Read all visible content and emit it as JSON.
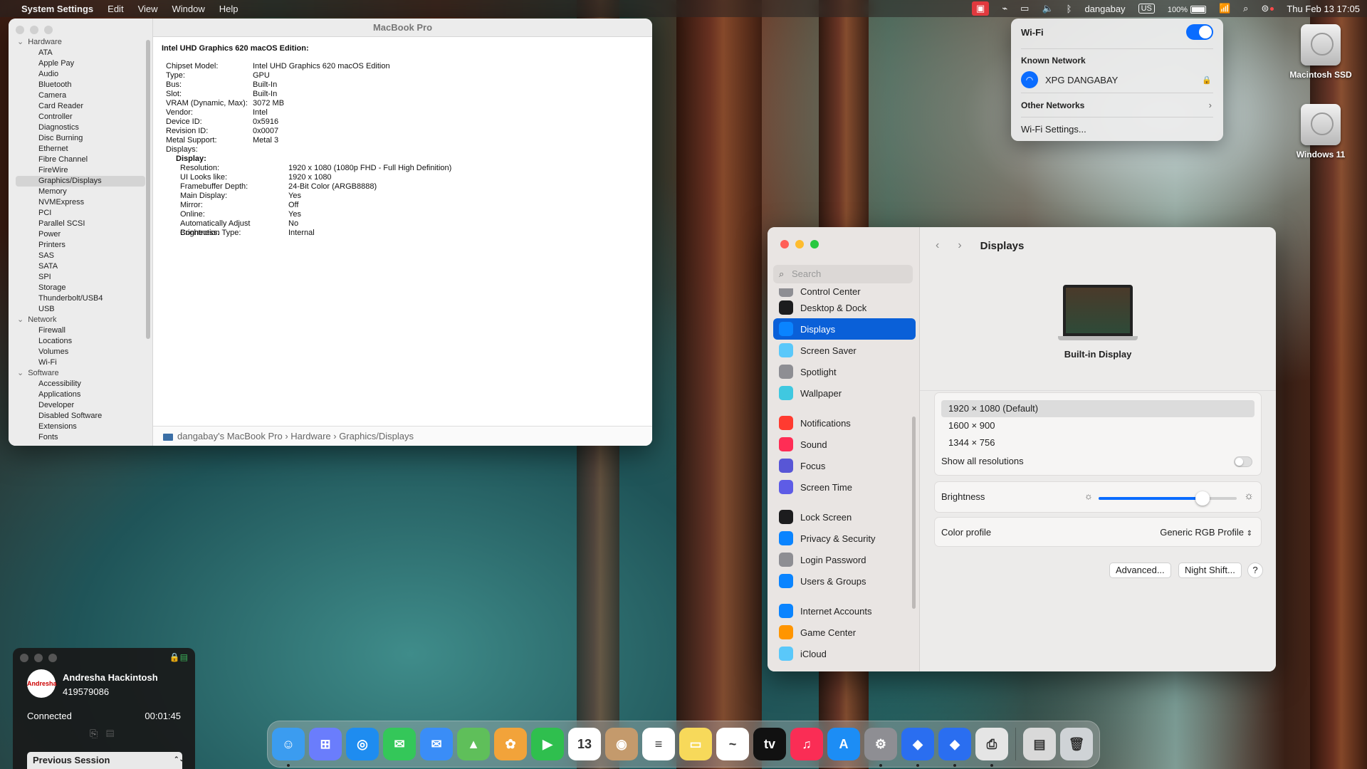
{
  "menubar": {
    "apple": "",
    "app": "System Settings",
    "menus": [
      "Edit",
      "View",
      "Window",
      "Help"
    ],
    "user": "dangabay",
    "input": "US",
    "battery": "100%",
    "datetime": "Thu Feb 13  17:05"
  },
  "info_window": {
    "title": "MacBook Pro",
    "sidebar": [
      {
        "label": "Hardware",
        "group": true
      },
      {
        "label": "ATA"
      },
      {
        "label": "Apple Pay"
      },
      {
        "label": "Audio"
      },
      {
        "label": "Bluetooth"
      },
      {
        "label": "Camera"
      },
      {
        "label": "Card Reader"
      },
      {
        "label": "Controller"
      },
      {
        "label": "Diagnostics"
      },
      {
        "label": "Disc Burning"
      },
      {
        "label": "Ethernet"
      },
      {
        "label": "Fibre Channel"
      },
      {
        "label": "FireWire"
      },
      {
        "label": "Graphics/Displays",
        "selected": true
      },
      {
        "label": "Memory"
      },
      {
        "label": "NVMExpress"
      },
      {
        "label": "PCI"
      },
      {
        "label": "Parallel SCSI"
      },
      {
        "label": "Power"
      },
      {
        "label": "Printers"
      },
      {
        "label": "SAS"
      },
      {
        "label": "SATA"
      },
      {
        "label": "SPI"
      },
      {
        "label": "Storage"
      },
      {
        "label": "Thunderbolt/USB4"
      },
      {
        "label": "USB"
      },
      {
        "label": "Network",
        "group": true
      },
      {
        "label": "Firewall"
      },
      {
        "label": "Locations"
      },
      {
        "label": "Volumes"
      },
      {
        "label": "Wi-Fi"
      },
      {
        "label": "Software",
        "group": true
      },
      {
        "label": "Accessibility"
      },
      {
        "label": "Applications"
      },
      {
        "label": "Developer"
      },
      {
        "label": "Disabled Software"
      },
      {
        "label": "Extensions"
      },
      {
        "label": "Fonts"
      }
    ],
    "heading": "Intel UHD Graphics 620 macOS Edition:",
    "fields": [
      [
        "Chipset Model:",
        "Intel UHD Graphics 620 macOS Edition"
      ],
      [
        "Type:",
        "GPU"
      ],
      [
        "Bus:",
        "Built-In"
      ],
      [
        "Slot:",
        "Built-In"
      ],
      [
        "VRAM (Dynamic, Max):",
        "3072 MB"
      ],
      [
        "Vendor:",
        "Intel"
      ],
      [
        "Device ID:",
        "0x5916"
      ],
      [
        "Revision ID:",
        "0x0007"
      ],
      [
        "Metal Support:",
        "Metal 3"
      ],
      [
        "Displays:",
        ""
      ]
    ],
    "display_heading": "Display:",
    "display_fields": [
      [
        "Resolution:",
        "1920 x 1080 (1080p FHD - Full High Definition)"
      ],
      [
        "UI Looks like:",
        "1920 x 1080"
      ],
      [
        "Framebuffer Depth:",
        "24-Bit Color (ARGB8888)"
      ],
      [
        "Main Display:",
        "Yes"
      ],
      [
        "Mirror:",
        "Off"
      ],
      [
        "Online:",
        "Yes"
      ],
      [
        "Automatically Adjust Brightness:",
        "No"
      ],
      [
        "Connection Type:",
        "Internal"
      ]
    ],
    "breadcrumb": "dangabay's MacBook Pro  ›  Hardware  ›  Graphics/Displays"
  },
  "wifi": {
    "title": "Wi-Fi",
    "known_label": "Known Network",
    "network": "XPG DANGABAY",
    "other": "Other Networks",
    "settings": "Wi-Fi Settings..."
  },
  "desktop": {
    "disk1": "Macintosh SSD",
    "disk2": "Windows 11"
  },
  "settings": {
    "search_placeholder": "Search",
    "sidebar": [
      {
        "label": "Control Center",
        "color": "#8e8e93",
        "partial": true
      },
      {
        "label": "Desktop & Dock",
        "color": "#1c1c1e"
      },
      {
        "label": "Displays",
        "color": "#0a84ff",
        "selected": true
      },
      {
        "label": "Screen Saver",
        "color": "#5ac8fa"
      },
      {
        "label": "Spotlight",
        "color": "#8e8e93"
      },
      {
        "label": "Wallpaper",
        "color": "#40c8e0",
        "gap_after": true
      },
      {
        "label": "Notifications",
        "color": "#ff3b30"
      },
      {
        "label": "Sound",
        "color": "#ff2d55"
      },
      {
        "label": "Focus",
        "color": "#5856d6"
      },
      {
        "label": "Screen Time",
        "color": "#5e5ce6",
        "gap_after": true
      },
      {
        "label": "Lock Screen",
        "color": "#1c1c1e"
      },
      {
        "label": "Privacy & Security",
        "color": "#0a84ff"
      },
      {
        "label": "Login Password",
        "color": "#8e8e93"
      },
      {
        "label": "Users & Groups",
        "color": "#0a84ff",
        "gap_after": true
      },
      {
        "label": "Internet Accounts",
        "color": "#0a84ff"
      },
      {
        "label": "Game Center",
        "color": "#ff9500"
      },
      {
        "label": "iCloud",
        "color": "#5ac8fa"
      }
    ],
    "page_title": "Displays",
    "display_name": "Built-in Display",
    "resolutions": [
      "1920 × 1080 (Default)",
      "1600 × 900",
      "1344 × 756"
    ],
    "show_all": "Show all resolutions",
    "brightness_label": "Brightness",
    "brightness": 0.75,
    "color_profile_label": "Color profile",
    "color_profile": "Generic RGB Profile",
    "advanced": "Advanced...",
    "night_shift": "Night Shift...",
    "help": "?"
  },
  "remote": {
    "name": "Andresha Hackintosh",
    "id": "419579086",
    "status": "Connected",
    "time": "00:01:45",
    "session": "Previous Session",
    "avatar": "Andresha"
  },
  "dock": [
    {
      "name": "finder",
      "color": "#3b9cf0",
      "glyph": "☺",
      "run": true
    },
    {
      "name": "launchpad",
      "color": "#6a7dfc",
      "glyph": "⊞"
    },
    {
      "name": "safari",
      "color": "#1e8cf0",
      "glyph": "◎"
    },
    {
      "name": "messages",
      "color": "#34c759",
      "glyph": "✉"
    },
    {
      "name": "mail",
      "color": "#3a8df7",
      "glyph": "✉"
    },
    {
      "name": "maps",
      "color": "#5fbf5a",
      "glyph": "▲"
    },
    {
      "name": "photos",
      "color": "#f2a33a",
      "glyph": "✿"
    },
    {
      "name": "facetime",
      "color": "#2fbf4e",
      "glyph": "▶"
    },
    {
      "name": "calendar",
      "color": "#ffffff",
      "glyph": "13",
      "dark": true
    },
    {
      "name": "contacts",
      "color": "#c49a6c",
      "glyph": "◉"
    },
    {
      "name": "reminders",
      "color": "#ffffff",
      "glyph": "≡",
      "dark": true
    },
    {
      "name": "notes",
      "color": "#f7d95a",
      "glyph": "▭"
    },
    {
      "name": "freeform",
      "color": "#ffffff",
      "glyph": "~",
      "dark": true
    },
    {
      "name": "tv",
      "color": "#111111",
      "glyph": "tv"
    },
    {
      "name": "music",
      "color": "#fa2d55",
      "glyph": "♫"
    },
    {
      "name": "app-store",
      "color": "#1c8df5",
      "glyph": "A"
    },
    {
      "name": "system-settings",
      "color": "#8e8e93",
      "glyph": "⚙",
      "run": true
    },
    {
      "name": "teamviewer",
      "color": "#2a6ef0",
      "glyph": "◆",
      "run": true
    },
    {
      "name": "teamviewer-session",
      "color": "#2a6ef0",
      "glyph": "◆",
      "run": true
    },
    {
      "name": "printer",
      "color": "#e5e5e5",
      "glyph": "⎙",
      "dark": true,
      "run": true
    },
    {
      "name": "separator"
    },
    {
      "name": "downloads",
      "color": "#d9d9d9",
      "glyph": "▤",
      "dark": true
    },
    {
      "name": "trash",
      "color": "#cfd3d6",
      "glyph": "🗑",
      "dark": true
    }
  ],
  "colors": {
    "accent": "#0a6cff",
    "selected_sidebar": "#0a60d8"
  }
}
